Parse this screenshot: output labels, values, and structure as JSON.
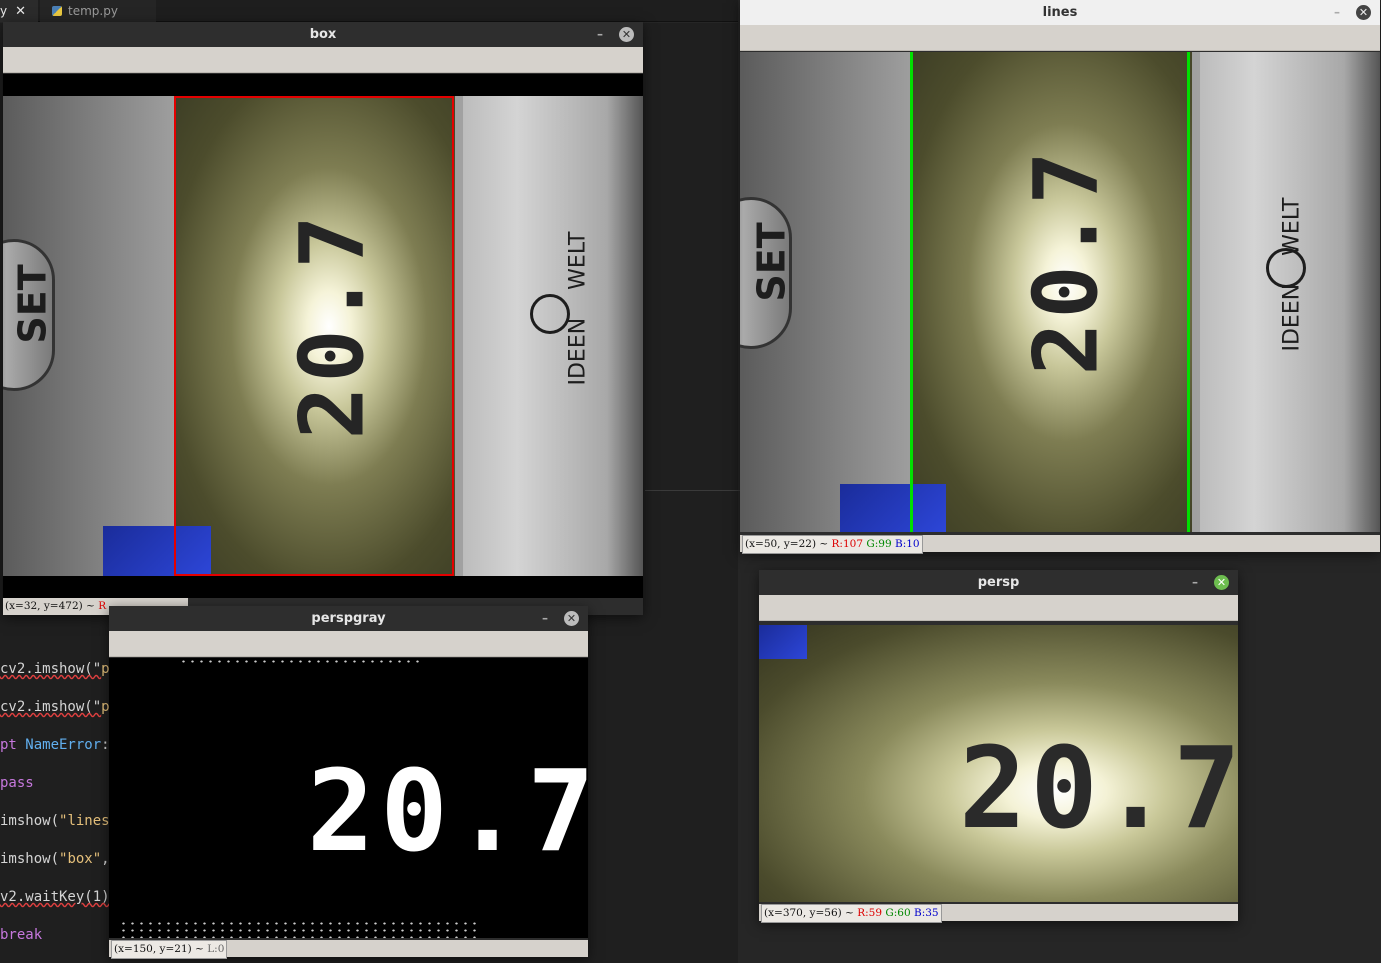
{
  "editor": {
    "tab_active": "y",
    "tab_close": "✕",
    "tab_inactive": "temp.py",
    "code_lines": [
      {
        "pre": "cv2.imshow(\"",
        "str": "p"
      },
      {
        "pre": "cv2.imshow(\"",
        "str": "p"
      },
      {
        "kw": "pt",
        "cls": " NameError",
        "post": ":"
      },
      {
        "kw": "pass"
      },
      {
        "pre": "imshow(",
        "str": "\"lines"
      },
      {
        "pre": "imshow(",
        "str": "\"box\"",
        "post": ","
      },
      {
        "pre": "v2.waitKey(1)"
      },
      {
        "kw": "break"
      }
    ]
  },
  "windows": {
    "box": {
      "title": "box",
      "minimize": "–",
      "close": "✕",
      "status": "(x=32, y=472) ~ ",
      "status_r": "R",
      "lcd_digits": "20.7",
      "set_label": "SET",
      "brand_label": "IDEEN",
      "brand_label2": "WELT"
    },
    "lines": {
      "title": "lines",
      "minimize": "–",
      "close": "✕",
      "status_pos": "(x=50, y=22) ~ ",
      "status_r": "R:107",
      "status_g": "G:99",
      "status_b": "B:10",
      "lcd_digits": "20.7",
      "set_label": "SET",
      "brand_label": "IDEEN",
      "brand_label2": "WELT"
    },
    "perspgray": {
      "title": "perspgray",
      "minimize": "–",
      "close": "✕",
      "status_pos": "(x=150, y=21) ~ ",
      "status_l": "L:0",
      "digits": "20.7"
    },
    "persp": {
      "title": "persp",
      "minimize": "–",
      "close": "✕",
      "status_pos": "(x=370, y=56) ~ ",
      "status_r": "R:59",
      "status_g": "G:60",
      "status_b": "B:35",
      "digits": "20.7"
    }
  }
}
